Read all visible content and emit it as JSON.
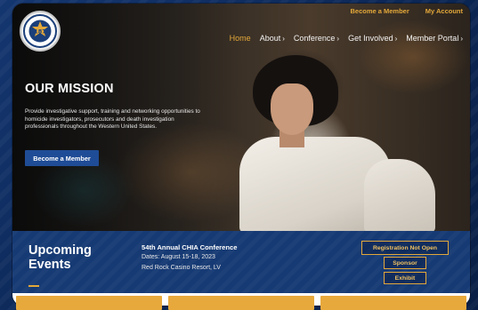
{
  "header": {
    "logo_icon": "badge-187-seal-icon",
    "logo_number": "187",
    "utility_links": [
      "Become a Member",
      "My Account"
    ]
  },
  "nav": {
    "items": [
      {
        "label": "Home",
        "active": true,
        "has_dropdown": false
      },
      {
        "label": "About",
        "active": false,
        "has_dropdown": true
      },
      {
        "label": "Conference",
        "active": false,
        "has_dropdown": true
      },
      {
        "label": "Get Involved",
        "active": false,
        "has_dropdown": true
      },
      {
        "label": "Member Portal",
        "active": false,
        "has_dropdown": true
      }
    ],
    "chevron": "›"
  },
  "hero": {
    "title": "OUR MISSION",
    "text": "Provide investigative support, training and networking opportunities to homicide investigators, prosecutors and death investigation professionals throughout the Western United States.",
    "cta_label": "Become a Member"
  },
  "events": {
    "title": "Upcoming Events",
    "conference_title": "54th Annual CHIA Conference",
    "dates": "Dates: August 15-18, 2023",
    "venue": "Red Rock Casino Resort, LV",
    "registration_label": "Registration Not Open",
    "sponsor_label": "Sponsor",
    "exhibit_label": "Exhibit"
  },
  "colors": {
    "accent": "#e3a83a",
    "brand_blue": "#163a74",
    "button_blue": "#1f4c96",
    "background": "#0d2a5c"
  }
}
